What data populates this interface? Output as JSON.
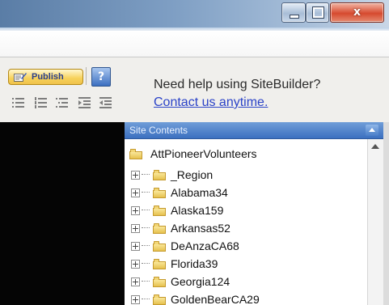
{
  "window": {
    "close_glyph": "x",
    "maximize_glyph": "",
    "minimize_glyph": ""
  },
  "toolbar": {
    "publish_label": "Publish",
    "help_icon": "?"
  },
  "help": {
    "text": "Need help using SiteBuilder?",
    "link": "Contact us anytime."
  },
  "site_contents": {
    "title": "Site Contents",
    "root": "AttPioneerVolunteers",
    "items": [
      {
        "label": "_Region"
      },
      {
        "label": "Alabama34"
      },
      {
        "label": "Alaska159"
      },
      {
        "label": "Arkansas52"
      },
      {
        "label": "DeAnzaCA68"
      },
      {
        "label": "Florida39"
      },
      {
        "label": "Georgia124"
      },
      {
        "label": "GoldenBearCA29"
      }
    ]
  },
  "colors": {
    "accent": "#3c70c0",
    "link": "#2b43c8",
    "publish": "#f7d15a"
  }
}
